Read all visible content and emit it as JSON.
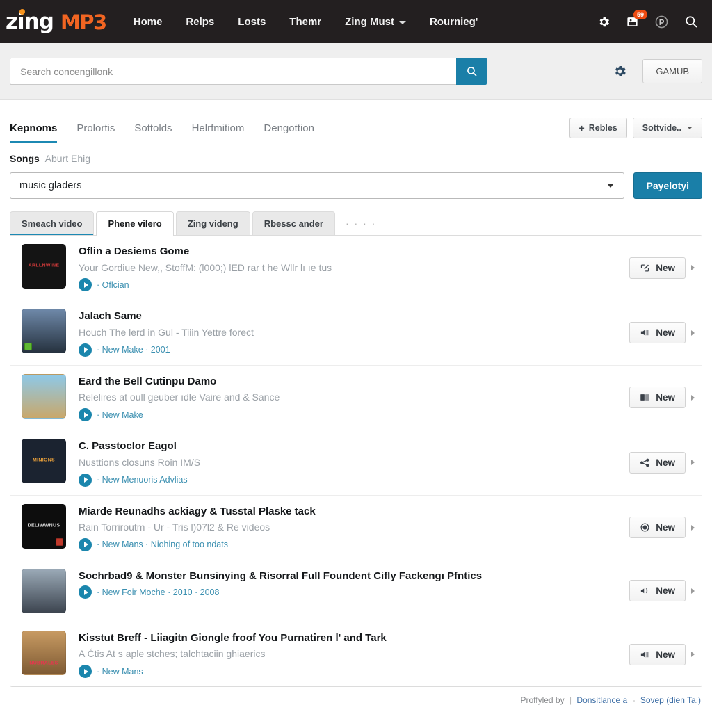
{
  "topnav": {
    "logo_primary": "zing",
    "logo_secondary": "MP3",
    "links": [
      {
        "label": "Home",
        "has_caret": false
      },
      {
        "label": "Relps",
        "has_caret": false
      },
      {
        "label": "Losts",
        "has_caret": false
      },
      {
        "label": "Themr",
        "has_caret": false
      },
      {
        "label": "Zing Must",
        "has_caret": true
      },
      {
        "label": "Rournieg'",
        "has_caret": false
      }
    ],
    "icons": {
      "gear": "gear-icon",
      "inbox": "inbox-icon",
      "inbox_badge": "59",
      "profile": "profile-icon",
      "search": "search-icon"
    }
  },
  "search": {
    "placeholder": "Search concengillonk",
    "value": "",
    "button_icon": "search-icon",
    "gear_icon": "gear-icon",
    "right_button": "GAMUB"
  },
  "main_tabs": {
    "items": [
      {
        "label": "Kepnoms",
        "active": true
      },
      {
        "label": "Prolortis",
        "active": false
      },
      {
        "label": "Sottolds",
        "active": false
      },
      {
        "label": "Helrfmitiom",
        "active": false
      },
      {
        "label": "Dengottion",
        "active": false
      }
    ],
    "add_button": "Rebles",
    "add_button_icon": "plus-icon",
    "dropdown_button": "Sottvide.."
  },
  "section": {
    "title": "Songs",
    "subtitle": "Aburt Ehig"
  },
  "selector": {
    "value": "music gladers",
    "caret_icon": "chevron-down-icon",
    "submit_label": "Payelotyi"
  },
  "sub_tabs": {
    "items": [
      {
        "label": "Smeach video",
        "current": false,
        "underlined": true
      },
      {
        "label": "Phene vilero",
        "current": true,
        "underlined": false
      },
      {
        "label": "Zing videng",
        "current": false,
        "underlined": false
      },
      {
        "label": "Rbessc ander",
        "current": false,
        "underlined": false
      }
    ],
    "overflow": "· · · ·"
  },
  "results": [
    {
      "title": "Oflin a Desiems Gome",
      "subtitle": "Your Gordiue New,, StoffM: (l000;) lED rar t he Wllr lı ıe tus",
      "meta": "· Oflcian",
      "action_label": "New",
      "action_icon": "screen-share-icon",
      "thumb": {
        "text": "ARLLNWINE",
        "bg": "#141414",
        "fg": "#d33a3a",
        "badge": "none"
      }
    },
    {
      "title": "Jalach Same",
      "subtitle": "Houch The lerd in Gul - Tiiin Yettre forect",
      "meta": "· New Make · 2001",
      "action_label": "New",
      "action_icon": "speaker-icon",
      "thumb": {
        "text": "",
        "bg": "#5a6f8c",
        "fg": "#ffffff",
        "badge": "left-green"
      }
    },
    {
      "title": "Eard the Bell Cutinpu Damo",
      "subtitle": "Relelires at oull geuber ıdle Vaire and & Sance",
      "meta": "· New Make",
      "action_label": "New",
      "action_icon": "window-icon",
      "thumb": {
        "text": "",
        "bg": "#7ab4d6",
        "fg": "#2a2a2a",
        "badge": "none"
      }
    },
    {
      "title": "C. Passtoclor Eagol",
      "subtitle": "Nusttions closuns Roin IM/S",
      "meta": "· New Menuoris  Advlias",
      "action_label": "New",
      "action_icon": "share-nodes-icon",
      "thumb": {
        "text": "MINIONS",
        "bg": "#1b2330",
        "fg": "#f0a43a",
        "badge": "none"
      }
    },
    {
      "title": "Miarde Reunadhs ackiagy & Tusstal Plaske tack",
      "subtitle": "Rain Torriroutm - Ur - Tris l)07l2 &  Re videos",
      "meta": "· New Mans · Niohing of too ndats",
      "action_label": "New",
      "action_icon": "record-icon",
      "thumb": {
        "text": "DELIWWNUS",
        "bg": "#0d0d0d",
        "fg": "#e2e2e2",
        "badge": "right-red"
      }
    },
    {
      "title": "Sochrbad9 & Monster Bunsinying &  Risorral Full Foundent Cifly Fackengı Pfntics",
      "subtitle": "",
      "meta": "· New Foir Moche · 2010 · 2008",
      "action_label": "New",
      "action_icon": "broadcast-icon",
      "thumb": {
        "text": "",
        "bg": "#7d8c99",
        "fg": "#ffffff",
        "badge": "none"
      }
    },
    {
      "title": "Kisstut Breff - Liiagitn Giongle froof You Purnatiren l' and Tark",
      "subtitle": "A Ćtis At s aple stches; talchtaciin ghiaerics",
      "meta": "· New Mans",
      "action_label": "New",
      "action_icon": "speaker-icon",
      "thumb": {
        "text": "NUBRALES",
        "bg": "#b07a4a",
        "fg": "#e8344f",
        "badge": "none"
      }
    }
  ],
  "footer": {
    "prefix": "Proffyled by",
    "sep1": "|",
    "link1": "Donsitlance a",
    "dash": "-",
    "link2": "Sovep (dien Ta,)"
  }
}
